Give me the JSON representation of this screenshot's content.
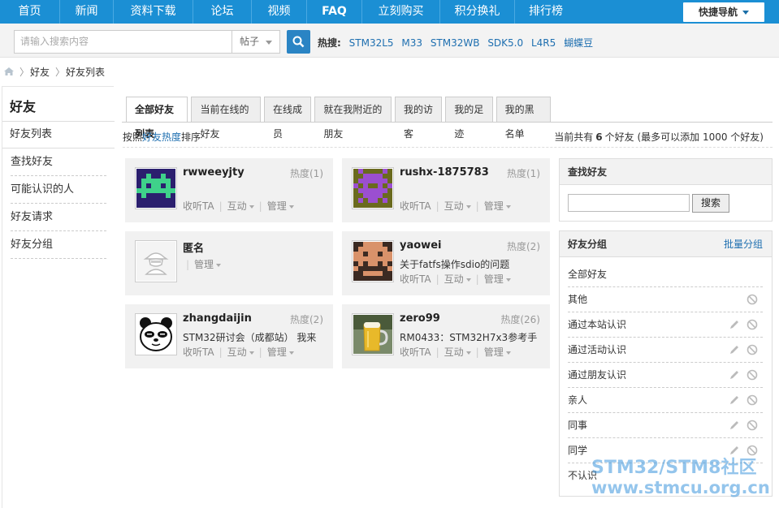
{
  "nav": {
    "items": [
      "首页",
      "新闻",
      "资料下载",
      "论坛",
      "视频",
      "FAQ",
      "立刻购买",
      "积分换礼",
      "排行榜"
    ],
    "quick": "快捷导航"
  },
  "search": {
    "placeholder": "请输入搜索内容",
    "type": "帖子",
    "hot_label": "热搜:",
    "hot": [
      "STM32L5",
      "M33",
      "STM32WB",
      "SDK5.0",
      "L4R5",
      "蝴蝶豆"
    ]
  },
  "breadcrumb": [
    "好友",
    "好友列表"
  ],
  "sidebar": {
    "title": "好友",
    "items": [
      "好友列表",
      "查找好友",
      "可能认识的人",
      "好友请求",
      "好友分组"
    ]
  },
  "tabs": [
    "全部好友列表",
    "当前在线的好友",
    "在线成员",
    "就在我附近的朋友",
    "我的访客",
    "我的足迹",
    "我的黑名单"
  ],
  "sort": {
    "prefix": "按照",
    "key": "好友热度",
    "suffix": "排序"
  },
  "count": {
    "prefix": "当前共有",
    "num": "6",
    "suffix": "个好友 (最多可以添加 1000 个好友)"
  },
  "actions": {
    "listen": "收听TA",
    "interact": "互动",
    "manage": "管理",
    "sep": "|"
  },
  "friends": [
    {
      "name": "rwweeyjty",
      "heat": "热度(1)",
      "sig": ""
    },
    {
      "name": "rushx-1875783",
      "heat": "热度(1)",
      "sig": ""
    },
    {
      "name": "匿名",
      "heat": "",
      "sig": ""
    },
    {
      "name": "yaowei",
      "heat": "热度(2)",
      "sig": "关于fatfs操作sdio的问题"
    },
    {
      "name": "zhangdaijin",
      "heat": "热度(2)",
      "sig": "STM32研讨会（成都站） 我来"
    },
    {
      "name": "zero99",
      "heat": "热度(26)",
      "sig": "RM0433：STM32H7x3参考手"
    }
  ],
  "find": {
    "title": "查找好友",
    "button": "搜索"
  },
  "groups": {
    "title": "好友分组",
    "batch": "批量分组",
    "items": [
      "全部好友",
      "其他",
      "通过本站认识",
      "通过活动认识",
      "通过朋友认识",
      "亲人",
      "同事",
      "同学",
      "不认识"
    ]
  },
  "watermark": {
    "line1": "STM32/STM8社区",
    "line2": "www.stmcu.org.cn"
  },
  "colors": {
    "nav": "#1b8fd4",
    "link": "#1e6fb0",
    "search_button": "#2a84c4"
  }
}
